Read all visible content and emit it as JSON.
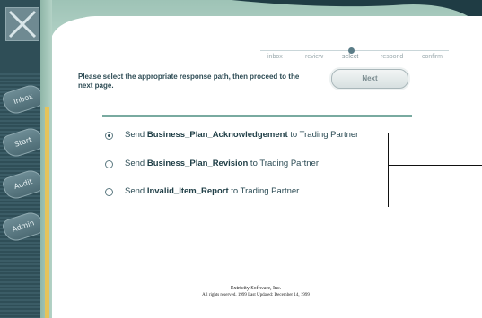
{
  "nav": {
    "items": [
      "Inbox",
      "Start",
      "Audit",
      "Admin"
    ]
  },
  "progress": {
    "steps": [
      "inbox",
      "review",
      "select",
      "respond",
      "confirm"
    ],
    "current": "select"
  },
  "instruction": "Please select the appropriate response path, then proceed to the next page.",
  "next_button": "Next",
  "options": [
    {
      "prefix": "Send ",
      "doc": "Business_Plan_Acknowledgement",
      "suffix": " to Trading Partner",
      "selected": true
    },
    {
      "prefix": "Send ",
      "doc": "Business_Plan_Revision",
      "suffix": " to Trading Partner",
      "selected": false
    },
    {
      "prefix": "Send ",
      "doc": "Invalid_Item_Report",
      "suffix": " to Trading Partner",
      "selected": false
    }
  ],
  "footer": {
    "company": "Extricity Software, Inc.",
    "rights": "All rights reserved. 1999 Last Updated: December 14, 1999"
  },
  "colors": {
    "sidebar": "#2f4e57",
    "frame": "#9ec3b6",
    "accent": "#e5c35a"
  }
}
